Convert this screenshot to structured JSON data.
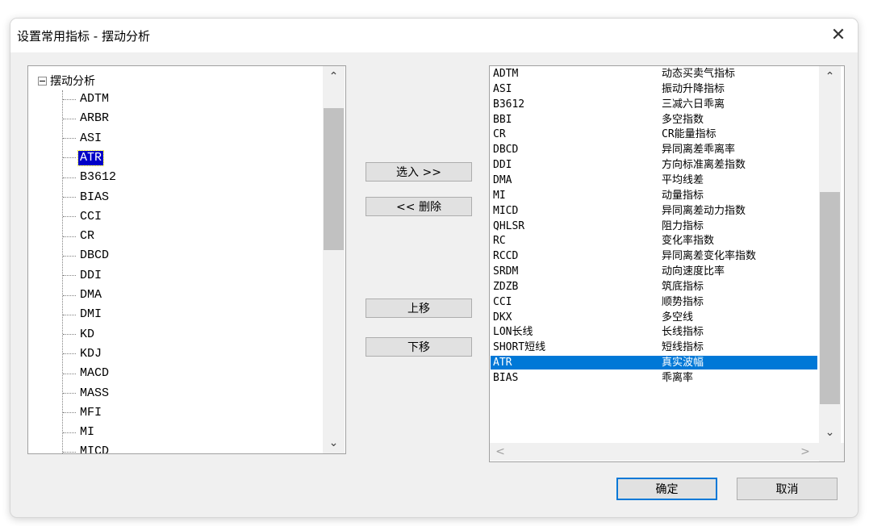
{
  "dialog": {
    "title": "设置常用指标 - 摆动分析",
    "close_glyph": "✕"
  },
  "tree": {
    "root_label": "摆动分析",
    "items": [
      "ADTM",
      "ARBR",
      "ASI",
      "ATR",
      "B3612",
      "BIAS",
      "CCI",
      "CR",
      "DBCD",
      "DDI",
      "DMA",
      "DMI",
      "KD",
      "KDJ",
      "MACD",
      "MASS",
      "MFI",
      "MI",
      "MICD"
    ],
    "selected": "ATR"
  },
  "buttons": {
    "add": "选入 >>",
    "remove": "<< 删除",
    "move_up": "上移",
    "move_down": "下移",
    "ok": "确定",
    "cancel": "取消"
  },
  "list": {
    "rows": [
      {
        "code": "ADTM",
        "name": "动态买卖气指标"
      },
      {
        "code": "ASI",
        "name": "振动升降指标"
      },
      {
        "code": "B3612",
        "name": "三减六日乖离"
      },
      {
        "code": "BBI",
        "name": "多空指数"
      },
      {
        "code": "CR",
        "name": "CR能量指标"
      },
      {
        "code": "DBCD",
        "name": "异同离差乖离率"
      },
      {
        "code": "DDI",
        "name": "方向标准离差指数"
      },
      {
        "code": "DMA",
        "name": "平均线差"
      },
      {
        "code": "MI",
        "name": "动量指标"
      },
      {
        "code": "MICD",
        "name": "异同离差动力指数"
      },
      {
        "code": "QHLSR",
        "name": "阻力指标"
      },
      {
        "code": "RC",
        "name": "变化率指数"
      },
      {
        "code": "RCCD",
        "name": "异同离差变化率指数"
      },
      {
        "code": "SRDM",
        "name": "动向速度比率"
      },
      {
        "code": "ZDZB",
        "name": "筑底指标"
      },
      {
        "code": "CCI",
        "name": "顺势指标"
      },
      {
        "code": "DKX",
        "name": "多空线"
      },
      {
        "code": "LON长线",
        "name": "长线指标"
      },
      {
        "code": "SHORT短线",
        "name": "短线指标"
      },
      {
        "code": "ATR",
        "name": "真实波幅"
      },
      {
        "code": "BIAS",
        "name": "乖离率"
      }
    ],
    "selected": "ATR"
  },
  "icons": {
    "up": "⌃",
    "down": "⌄",
    "left": "<",
    "right": ">"
  },
  "colors": {
    "selection_list": "#0078d7",
    "selection_tree": "#0000c8",
    "default_button_border": "#0078d7"
  }
}
